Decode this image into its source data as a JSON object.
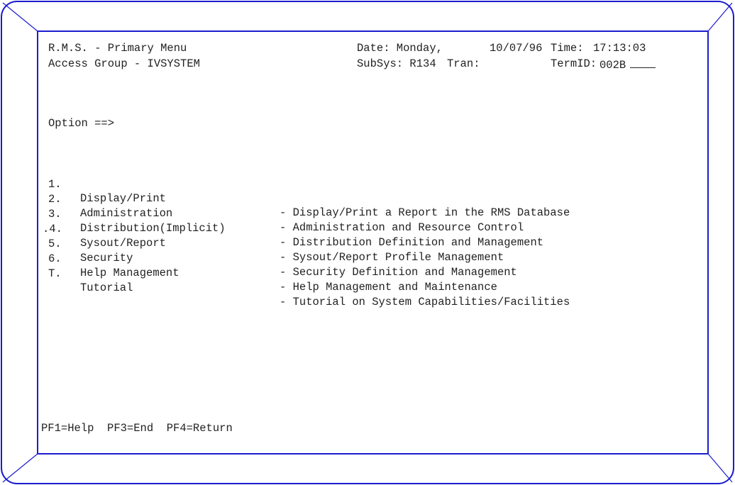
{
  "header": {
    "title": "R.M.S. - Primary Menu",
    "access_group": "Access Group - IVSYSTEM",
    "date_label": "Date: Monday,",
    "date_value": "10/07/96",
    "time_label": "Time:",
    "time_value": "17:13:03",
    "subsys": "SubSys: R134",
    "tran_label": "Tran:",
    "termid_label": "TermID:",
    "termid_value": "002B"
  },
  "option": {
    "prompt": "Option ==>",
    "value": ""
  },
  "menu": [
    {
      "num": "1.",
      "name": "Display/Print",
      "desc": "- Display/Print a Report in the RMS Database"
    },
    {
      "num": "2.",
      "name": "Administration",
      "desc": "- Administration and Resource Control"
    },
    {
      "num": "3.",
      "name": "Distribution(Implicit)",
      "desc": "- Distribution Definition and Management"
    },
    {
      "num": ".4.",
      "name": "Sysout/Report",
      "desc": "- Sysout/Report Profile Management"
    },
    {
      "num": "5.",
      "name": "Security",
      "desc": "- Security Definition and Management"
    },
    {
      "num": "6.",
      "name": "Help Management",
      "desc": "- Help Management and Maintenance"
    },
    {
      "num": "T.",
      "name": "Tutorial",
      "desc": "- Tutorial on System Capabilities/Facilities"
    }
  ],
  "function_keys": "PF1=Help  PF3=End  PF4=Return",
  "colors": {
    "frame_border": "#1c1ccf",
    "text": "#222222"
  }
}
